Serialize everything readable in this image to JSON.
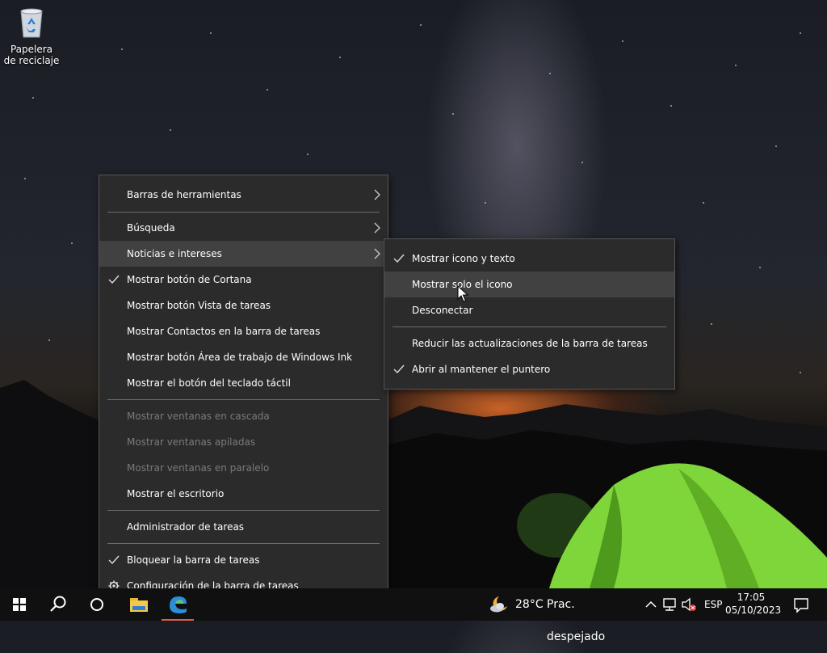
{
  "desktop": {
    "recycle_bin": {
      "label": "Papelera de reciclaje",
      "icon": "recycle-bin-icon"
    }
  },
  "context_menu": {
    "items": [
      {
        "label": "Barras de herramientas",
        "checked": false,
        "submenu": true,
        "disabled": false
      },
      {
        "label": "Búsqueda",
        "checked": false,
        "submenu": true,
        "disabled": false
      },
      {
        "label": "Noticias e intereses",
        "checked": false,
        "submenu": true,
        "disabled": false,
        "highlighted": true
      },
      {
        "label": "Mostrar botón de Cortana",
        "checked": true,
        "submenu": false,
        "disabled": false
      },
      {
        "label": "Mostrar botón Vista de tareas",
        "checked": false,
        "submenu": false,
        "disabled": false
      },
      {
        "label": "Mostrar Contactos en la barra de tareas",
        "checked": false,
        "submenu": false,
        "disabled": false
      },
      {
        "label": "Mostrar botón Área de trabajo de Windows Ink",
        "checked": false,
        "submenu": false,
        "disabled": false
      },
      {
        "label": "Mostrar el botón del teclado táctil",
        "checked": false,
        "submenu": false,
        "disabled": false
      },
      {
        "label": "Mostrar ventanas en cascada",
        "checked": false,
        "submenu": false,
        "disabled": true
      },
      {
        "label": "Mostrar ventanas apiladas",
        "checked": false,
        "submenu": false,
        "disabled": true
      },
      {
        "label": "Mostrar ventanas en paralelo",
        "checked": false,
        "submenu": false,
        "disabled": true
      },
      {
        "label": "Mostrar el escritorio",
        "checked": false,
        "submenu": false,
        "disabled": false
      },
      {
        "label": "Administrador de tareas",
        "checked": false,
        "submenu": false,
        "disabled": false
      },
      {
        "label": "Bloquear la barra de tareas",
        "checked": true,
        "submenu": false,
        "disabled": false
      },
      {
        "label": "Configuración de la barra de tareas",
        "checked": false,
        "submenu": false,
        "disabled": false,
        "icon": "gear-icon"
      }
    ]
  },
  "submenu": {
    "items": [
      {
        "label": "Mostrar icono y texto",
        "checked": true
      },
      {
        "label": "Mostrar solo el icono",
        "checked": false,
        "highlighted": true
      },
      {
        "label": "Desconectar",
        "checked": false
      },
      {
        "label": "Reducir las actualizaciones de la barra de tareas",
        "checked": false
      },
      {
        "label": "Abrir al mantener el puntero",
        "checked": true
      }
    ]
  },
  "taskbar": {
    "weather": {
      "temperature": "28°C",
      "condition": "Prac. despejado",
      "icon": "moon-cloud-icon"
    },
    "language": "ESP",
    "time": "17:05",
    "date": "05/10/2023",
    "accent_color": "#e35b47"
  }
}
